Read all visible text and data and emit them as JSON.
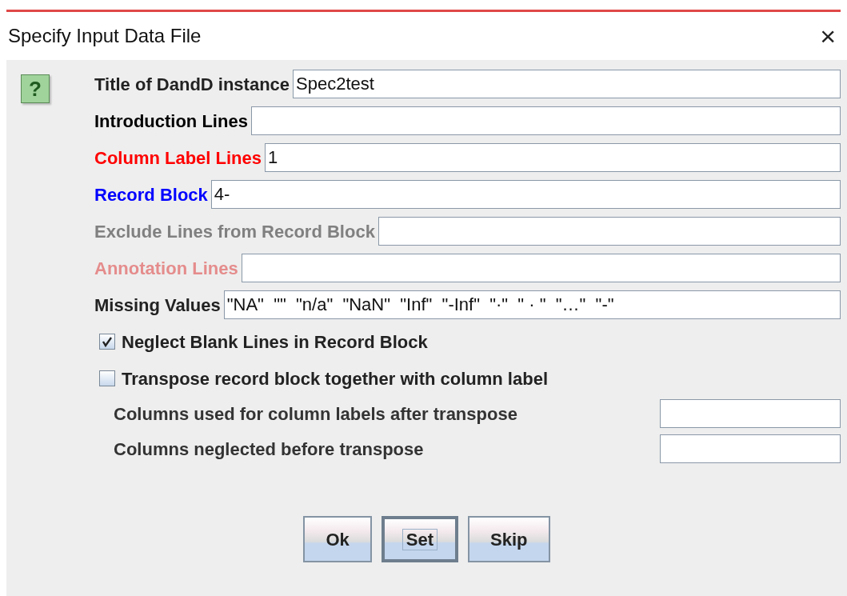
{
  "window": {
    "title": "Specify Input Data File",
    "close": "×"
  },
  "help": "?",
  "fields": [
    {
      "label": "Title of DandD instance",
      "value": "Spec2test",
      "color": "#222222"
    },
    {
      "label": "Introduction Lines",
      "color": "#000000"
    },
    {
      "label": "Column Label Lines",
      "value": "1",
      "color": "#ff0000"
    },
    {
      "label": "Record Block",
      "value": "4-",
      "color": "#0000ff"
    },
    {
      "label": "Exclude Lines from Record Block",
      "color": "#808080"
    },
    {
      "label": "Annotation Lines",
      "color": "#e58c8c"
    },
    {
      "label": "Missing Values",
      "value": "\"NA\"  \"\"  \"n/a\"  \"NaN\"  \"Inf\"  \"-Inf\"  \"·\"  \" · \"  \"…\"  \"-\"",
      "color": "#222222"
    }
  ],
  "checkboxes": [
    {
      "label": "Neglect Blank Lines in Record Block",
      "checked": true
    },
    {
      "label": "Transpose record block together with column label",
      "checked": false
    }
  ],
  "transpose_fields": [
    {
      "label": "Columns used for column labels after transpose"
    },
    {
      "label": "Columns neglected before transpose"
    }
  ],
  "buttons": [
    {
      "label": "Ok",
      "default": false
    },
    {
      "label": "Set",
      "default": true
    },
    {
      "label": "Skip",
      "default": false
    }
  ]
}
